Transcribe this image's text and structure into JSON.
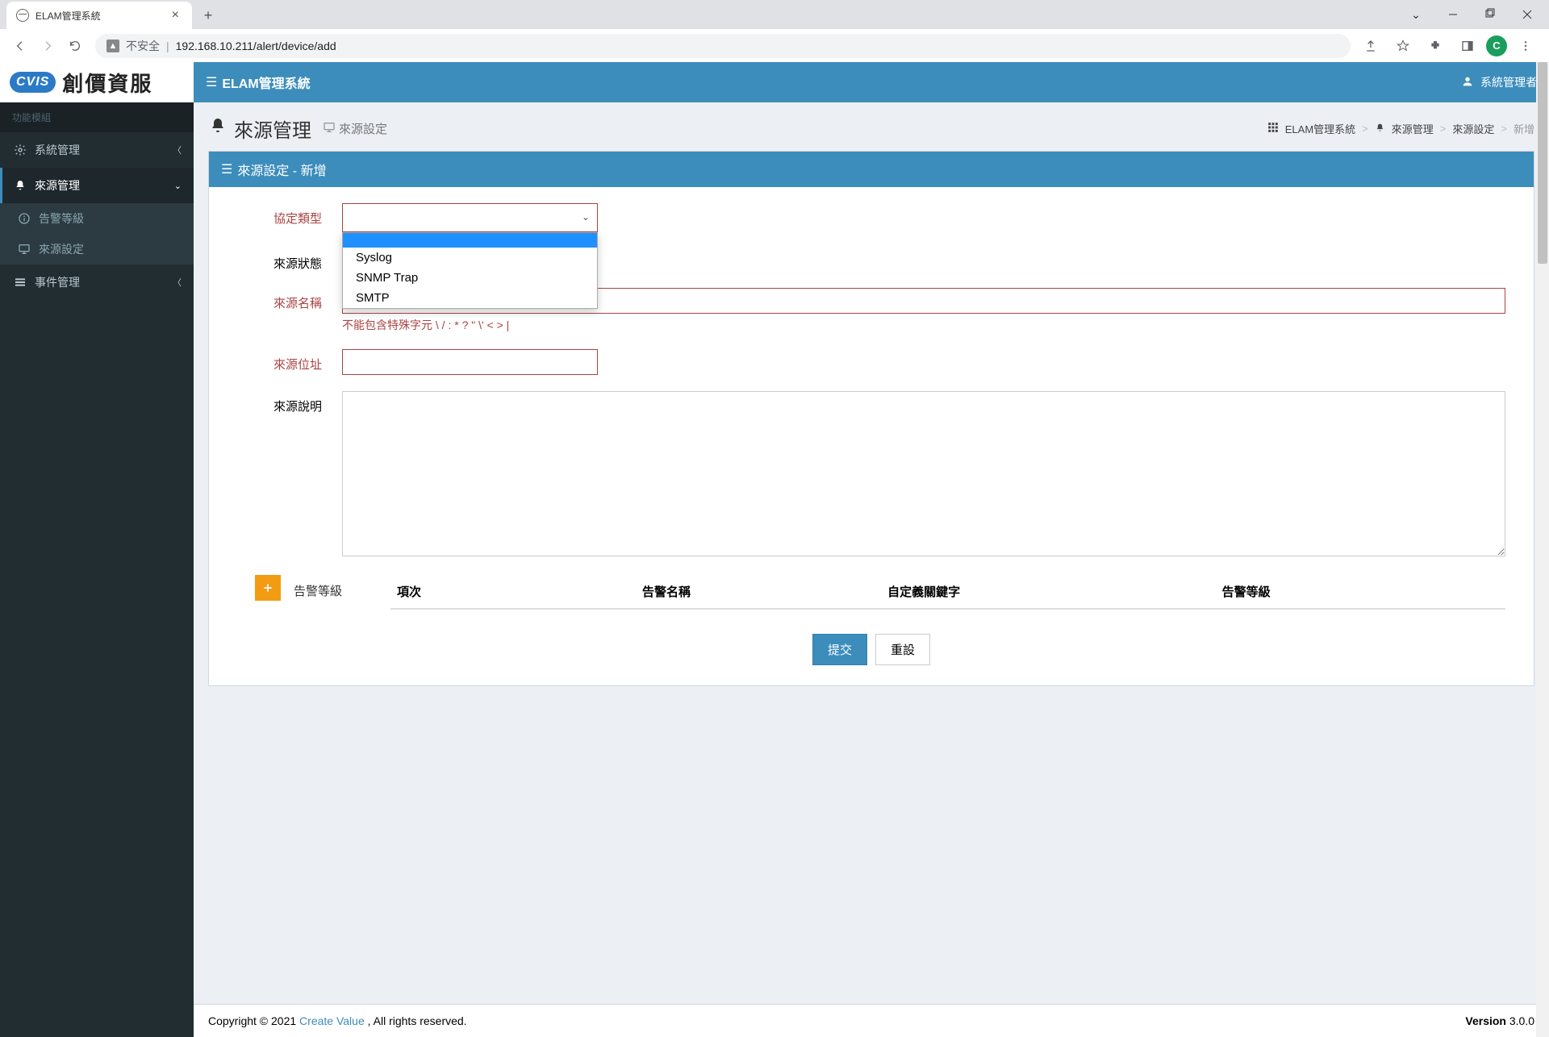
{
  "browser": {
    "tab_title": "ELAM管理系統",
    "insecure_label": "不安全",
    "url": "192.168.10.211/alert/device/add",
    "profile_letter": "C"
  },
  "logo": {
    "badge": "CVIS",
    "text": "創價資服"
  },
  "sidebar": {
    "section_label": "功能模組",
    "items": {
      "system": "系統管理",
      "source": "來源管理",
      "alert_level": "告警等級",
      "source_setting": "來源設定",
      "event": "事件管理"
    }
  },
  "topbar": {
    "title": "ELAM管理系統",
    "user": "系統管理者"
  },
  "header": {
    "title": "來源管理",
    "subtitle": "來源設定"
  },
  "breadcrumb": {
    "root": "ELAM管理系統",
    "lvl1": "來源管理",
    "lvl2": "來源設定",
    "lvl3": "新增"
  },
  "panel": {
    "title": "來源設定 - 新增"
  },
  "form": {
    "protocol_label": "協定類型",
    "protocol_value": "",
    "protocol_options": [
      "",
      "Syslog",
      "SNMP Trap",
      "SMTP"
    ],
    "status_label": "來源狀態",
    "name_label": "來源名稱",
    "name_value": "",
    "name_help": "不能包含特殊字元 \\ / : * ? \" \\' < > |",
    "address_label": "來源位址",
    "address_value": "",
    "desc_label": "來源說明",
    "desc_value": ""
  },
  "alert_table": {
    "section_label": "告警等級",
    "columns": {
      "seq": "項次",
      "name": "告警名稱",
      "keyword": "自定義關鍵字",
      "level": "告警等級"
    }
  },
  "actions": {
    "submit": "提交",
    "reset": "重設"
  },
  "footer": {
    "copyright": "Copyright © 2021 ",
    "brand": "Create Value",
    "rights": ", All rights reserved.",
    "version_label": "Version ",
    "version": "3.0.0"
  }
}
